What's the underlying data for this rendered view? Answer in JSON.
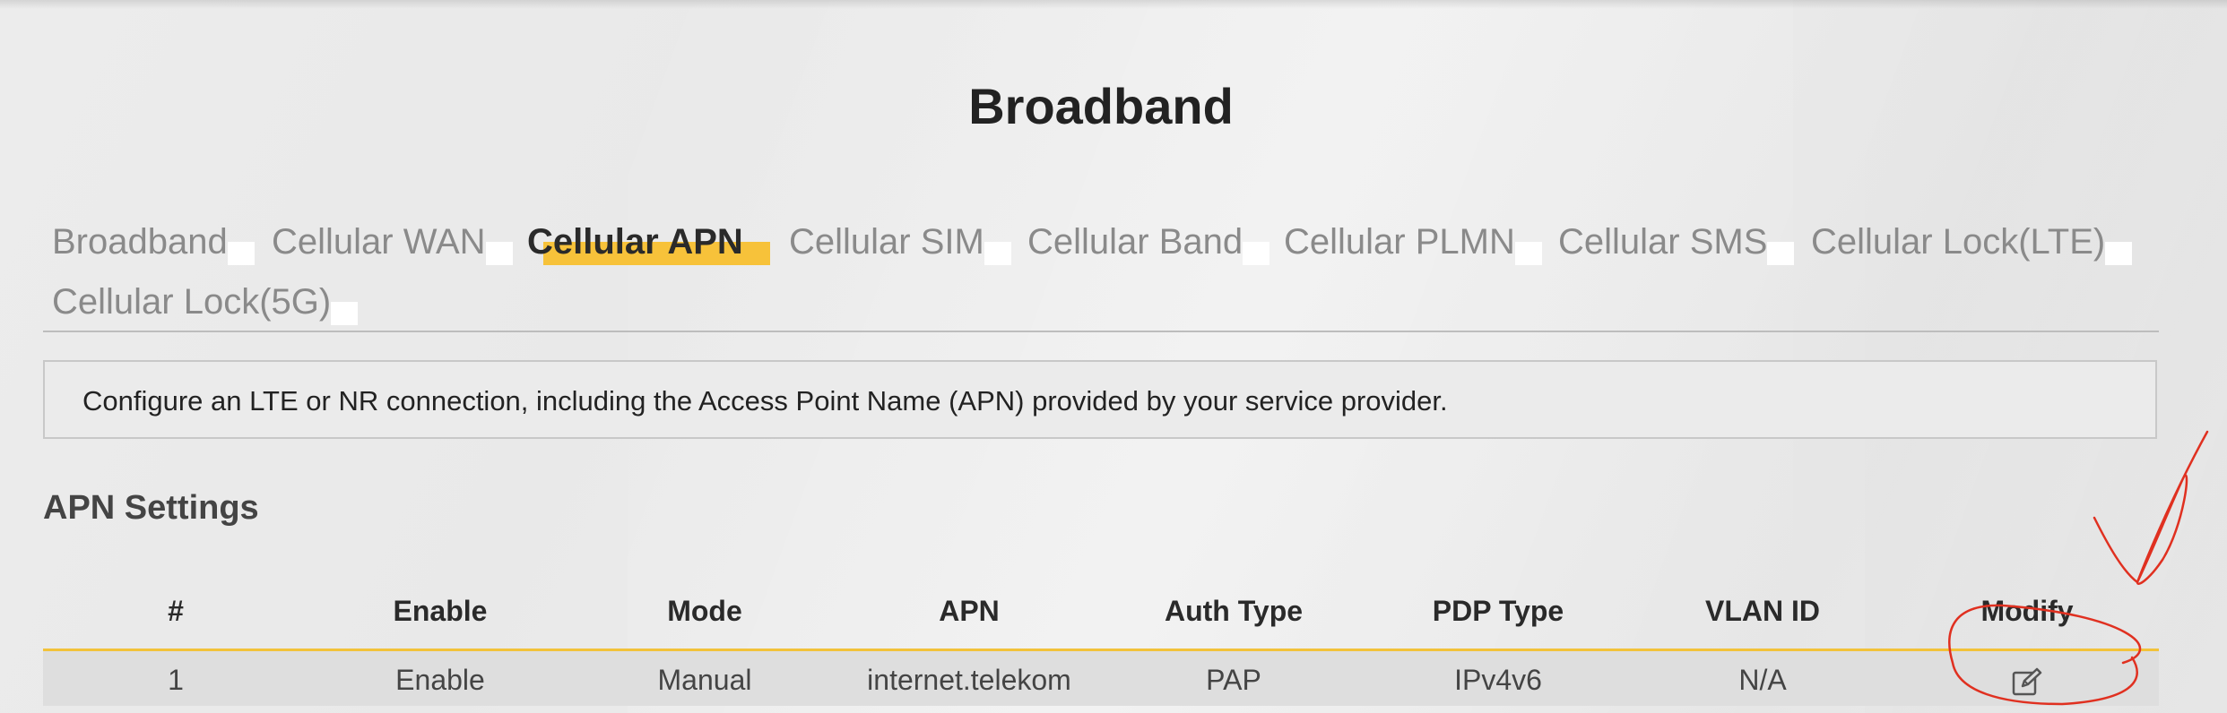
{
  "page": {
    "title": "Broadband"
  },
  "tabs": [
    {
      "label": "Broadband",
      "active": false
    },
    {
      "label": "Cellular WAN",
      "active": false
    },
    {
      "label": "Cellular APN",
      "active": true
    },
    {
      "label": "Cellular SIM",
      "active": false
    },
    {
      "label": "Cellular Band",
      "active": false
    },
    {
      "label": "Cellular PLMN",
      "active": false
    },
    {
      "label": "Cellular SMS",
      "active": false
    },
    {
      "label": "Cellular Lock(LTE)",
      "active": false
    },
    {
      "label": "Cellular Lock(5G)",
      "active": false
    }
  ],
  "info": {
    "text": "Configure an LTE or NR connection, including the Access Point Name (APN) provided by your service provider."
  },
  "apn_settings": {
    "title": "APN Settings",
    "columns": [
      "#",
      "Enable",
      "Mode",
      "APN",
      "Auth Type",
      "PDP Type",
      "VLAN ID",
      "Modify"
    ],
    "rows": [
      {
        "index": "1",
        "enable": "Enable",
        "mode": "Manual",
        "apn": "internet.telekom",
        "auth_type": "PAP",
        "pdp_type": "IPv4v6",
        "vlan_id": "N/A",
        "modify_icon": "edit-icon"
      }
    ]
  },
  "colors": {
    "accent": "#f7c23a",
    "annotation": "#e03020"
  }
}
